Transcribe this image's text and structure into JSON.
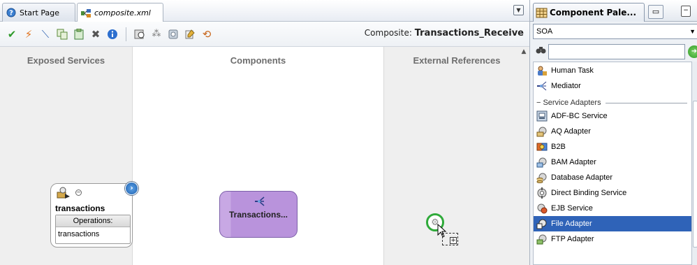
{
  "editor": {
    "tabs": [
      {
        "label": "Start Page",
        "icon": "help-circle-icon"
      },
      {
        "label": "composite.xml",
        "icon": "composite-icon"
      }
    ],
    "composite_prefix": "Composite:",
    "composite_name": "Transactions_Receive",
    "toolbar_icons": [
      "validate-check-icon",
      "deploy-lightning-icon",
      "wire-icon",
      "copy-icon",
      "paste-icon",
      "delete-icon",
      "info-icon",
      "zoom-icon",
      "layout-icon",
      "test-icon",
      "edit-icon",
      "refresh-icon"
    ],
    "lanes": {
      "exposed": "Exposed Services",
      "components": "Components",
      "external": "External References"
    },
    "service": {
      "name": "transactions",
      "operations_header": "Operations:",
      "operation": "transactions"
    },
    "mediator": {
      "label": "Transactions..."
    }
  },
  "palette": {
    "tab_label": "Component Pale...",
    "category": "SOA",
    "search_value": "",
    "items_top": [
      {
        "label": "Human Task",
        "icon": "human-task-icon"
      },
      {
        "label": "Mediator",
        "icon": "mediator-icon"
      }
    ],
    "section_header": "Service Adapters",
    "adapters": [
      {
        "label": "ADF-BC Service",
        "icon": "adf-bc-icon",
        "selected": false
      },
      {
        "label": "AQ Adapter",
        "icon": "aq-adapter-icon",
        "selected": false
      },
      {
        "label": "B2B",
        "icon": "b2b-icon",
        "selected": false
      },
      {
        "label": "BAM Adapter",
        "icon": "bam-adapter-icon",
        "selected": false
      },
      {
        "label": "Database Adapter",
        "icon": "database-adapter-icon",
        "selected": false
      },
      {
        "label": "Direct Binding Service",
        "icon": "direct-binding-icon",
        "selected": false
      },
      {
        "label": "EJB Service",
        "icon": "ejb-service-icon",
        "selected": false
      },
      {
        "label": "File Adapter",
        "icon": "file-adapter-icon",
        "selected": true
      },
      {
        "label": "FTP Adapter",
        "icon": "ftp-adapter-icon",
        "selected": false
      }
    ]
  },
  "colors": {
    "selection": "#2f63b8",
    "mediator_fill": "#b993dc",
    "lane_gray": "#efefef",
    "drag_ring": "#2faa3a"
  }
}
